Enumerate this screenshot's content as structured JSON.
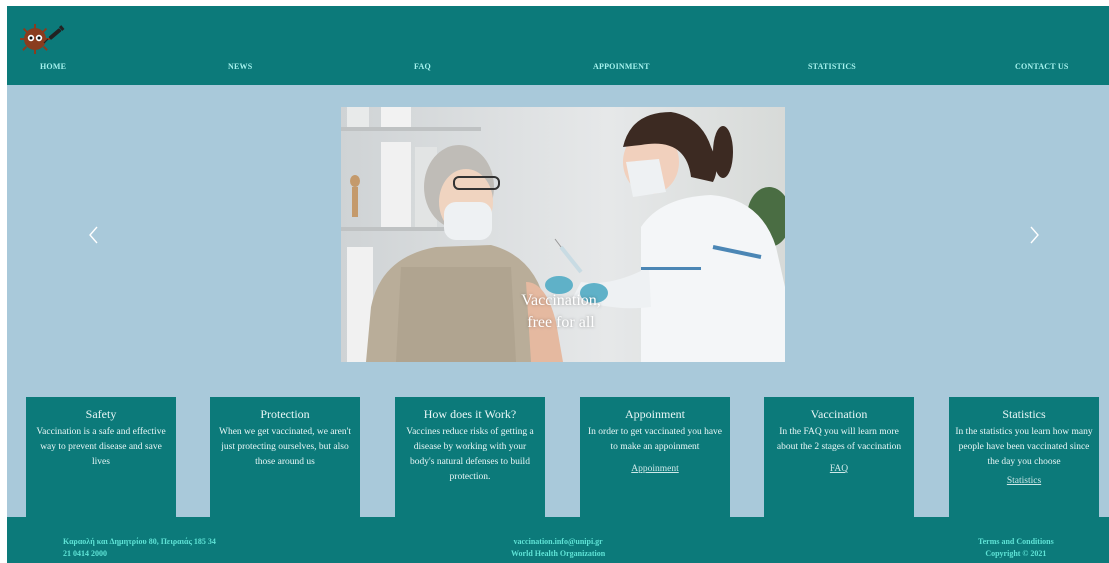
{
  "nav": {
    "items": [
      {
        "label": "HOME"
      },
      {
        "label": "NEWS"
      },
      {
        "label": "FAQ"
      },
      {
        "label": "APPOINMENT"
      },
      {
        "label": "STATISTICS"
      },
      {
        "label": "CONTACT US"
      }
    ]
  },
  "hero": {
    "caption_line1": "Vaccination,",
    "caption_line2": "free for all",
    "prev_icon": "chevron-left-icon",
    "next_icon": "chevron-right-icon"
  },
  "cards": [
    {
      "title": "Safety",
      "text": "Vaccination is a safe and effective way to prevent disease and save lives",
      "link": ""
    },
    {
      "title": "Protection",
      "text": "When we get vaccinated, we aren't just protecting ourselves, but also those around us",
      "link": ""
    },
    {
      "title": "How does it Work?",
      "text": "Vaccines reduce risks of getting a disease by working with your body's natural defenses to build protection.",
      "link": ""
    },
    {
      "title": "Appoinment",
      "text": "In order to get vaccinated you have to make an appoinment",
      "link": "Appoinment"
    },
    {
      "title": "Vaccination",
      "text": "In the FAQ you will learn more about the 2 stages of vaccination",
      "link": "FAQ"
    },
    {
      "title": "Statistics",
      "text": "In the statistics you learn how many people have been vaccinated since the day you choose",
      "link": "Statistics"
    }
  ],
  "footer": {
    "address": "Καραολή και Δημητρίου 80, Πειραιάς 185 34",
    "phone": "21 0414 2000",
    "email": "vaccination.info@unipi.gr",
    "org": "World Health Organization",
    "terms": "Terms and Conditions",
    "copyright": "Copyright © 2021"
  },
  "colors": {
    "header": "#0c7a7a",
    "background": "#a9c9da",
    "nav_text": "#a6f2ee",
    "footer_text": "#5fe3d6"
  }
}
